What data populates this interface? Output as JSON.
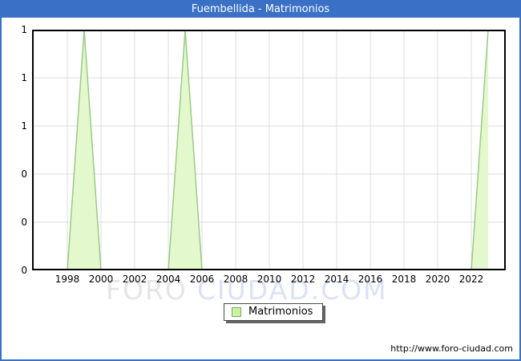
{
  "window": {
    "title": "Fuembellida - Matrimonios"
  },
  "colors": {
    "titlebar_bg": "#3a71c6",
    "frame_border": "#3a71c6",
    "area_fill": "#e3f8cd",
    "area_line": "#9acb86",
    "gridline": "#dcdcdc",
    "plot_border": "#000000",
    "legend_swatch_fill": "#ccf2a6",
    "legend_swatch_border": "#77a95e",
    "watermark_gray": "#e5e5e5",
    "watermark_blue": "#dbe2f6"
  },
  "legend": {
    "items": [
      {
        "label": "Matrimonios"
      }
    ]
  },
  "watermark": {
    "text_left": "FORO",
    "text_right": "CIUDAD.COM"
  },
  "footer": {
    "url": "http://www.foro-ciudad.com"
  },
  "chart_data": {
    "type": "area",
    "title": "Fuembellida - Matrimonios",
    "series": [
      {
        "name": "Matrimonios",
        "x": [
          1996,
          1997,
          1998,
          1999,
          2000,
          2001,
          2002,
          2003,
          2004,
          2005,
          2006,
          2007,
          2008,
          2009,
          2010,
          2011,
          2012,
          2013,
          2014,
          2015,
          2016,
          2017,
          2018,
          2019,
          2020,
          2021,
          2022,
          2023
        ],
        "values": [
          0,
          0,
          0,
          1,
          0,
          0,
          0,
          0,
          0,
          1,
          0,
          0,
          0,
          0,
          0,
          0,
          0,
          0,
          0,
          0,
          0,
          0,
          0,
          0,
          0,
          0,
          0,
          1
        ]
      }
    ],
    "xlim": [
      1996,
      2024.1
    ],
    "ylim": [
      0,
      1
    ],
    "x_ticks": [
      1998,
      2000,
      2002,
      2004,
      2006,
      2008,
      2010,
      2012,
      2014,
      2016,
      2018,
      2020,
      2022
    ],
    "y_ticks": {
      "values": [
        1,
        0.8,
        0.6,
        0.4,
        0.2,
        0
      ],
      "labels": [
        "1",
        "1",
        "1",
        "0",
        "0",
        "0"
      ]
    },
    "grid": true,
    "legend_position": "bottom-center"
  }
}
